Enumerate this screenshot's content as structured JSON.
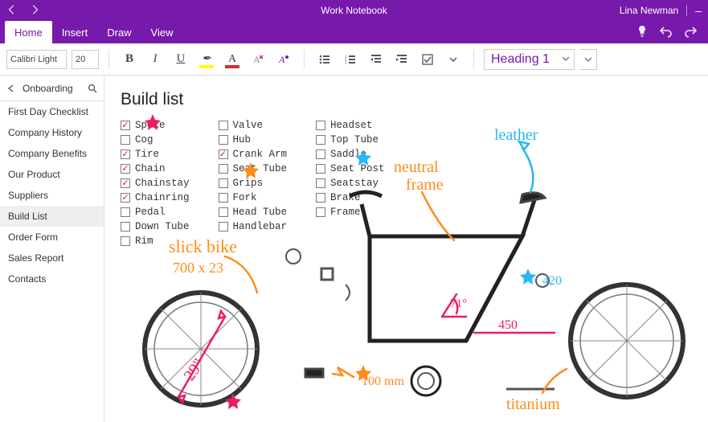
{
  "colors": {
    "brand": "#7719aa",
    "ink_orange": "#ff8c1a",
    "ink_pink": "#e91e63",
    "ink_blue": "#29b6f6"
  },
  "titlebar": {
    "title": "Work Notebook",
    "user": "Lina Newman"
  },
  "tabs": [
    {
      "label": "Home",
      "active": true
    },
    {
      "label": "Insert",
      "active": false
    },
    {
      "label": "Draw",
      "active": false
    },
    {
      "label": "View",
      "active": false
    }
  ],
  "ribbon": {
    "font_name": "Calibri Light",
    "font_size": "20",
    "style_selected": "Heading 1",
    "highlight_color": "#ffff00",
    "font_color": "#d32f2f"
  },
  "sidebar": {
    "section": "Onboarding",
    "pages": [
      {
        "label": "First Day Checklist",
        "selected": false
      },
      {
        "label": "Company History",
        "selected": false
      },
      {
        "label": "Company Benefits",
        "selected": false
      },
      {
        "label": "Our Product",
        "selected": false
      },
      {
        "label": "Suppliers",
        "selected": false
      },
      {
        "label": "Build List",
        "selected": true
      },
      {
        "label": "Order Form",
        "selected": false
      },
      {
        "label": "Sales Report",
        "selected": false
      },
      {
        "label": "Contacts",
        "selected": false
      }
    ]
  },
  "page": {
    "title": "Build list",
    "columns": [
      [
        {
          "label": "Spoke",
          "checked": true
        },
        {
          "label": "Cog",
          "checked": false,
          "star": "pink"
        },
        {
          "label": "Tire",
          "checked": true
        },
        {
          "label": "Chain",
          "checked": true
        },
        {
          "label": "Chainstay",
          "checked": true
        },
        {
          "label": "Chainring",
          "checked": true
        },
        {
          "label": "Pedal",
          "checked": false
        },
        {
          "label": "Down Tube",
          "checked": false
        },
        {
          "label": "Rim",
          "checked": false
        }
      ],
      [
        {
          "label": "Valve",
          "checked": false
        },
        {
          "label": "Hub",
          "checked": false
        },
        {
          "label": "Crank Arm",
          "checked": true
        },
        {
          "label": "Seat Tube",
          "checked": false
        },
        {
          "label": "Grips",
          "checked": false
        },
        {
          "label": "Fork",
          "checked": false,
          "star": "orange"
        },
        {
          "label": "Head Tube",
          "checked": false
        },
        {
          "label": "Handlebar",
          "checked": false
        }
      ],
      [
        {
          "label": "Headset",
          "checked": false
        },
        {
          "label": "Top Tube",
          "checked": false
        },
        {
          "label": "Saddle",
          "checked": false
        },
        {
          "label": "Seat Post",
          "checked": false
        },
        {
          "label": "Seatstay",
          "checked": false,
          "star": "blue"
        },
        {
          "label": "Brake",
          "checked": false
        },
        {
          "label": "Frame",
          "checked": false
        }
      ]
    ],
    "ink_labels": {
      "slick_bike": "slick bike",
      "dim_700x23": "700 x 23",
      "wheel_29in": "29\"",
      "neutral_frame_1": "neutral",
      "neutral_frame_2": "frame",
      "leather": "leather",
      "angle_71": "71°",
      "length_450": "450",
      "length_420": "420",
      "length_100mm": "100 mm",
      "titanium": "titanium"
    }
  }
}
